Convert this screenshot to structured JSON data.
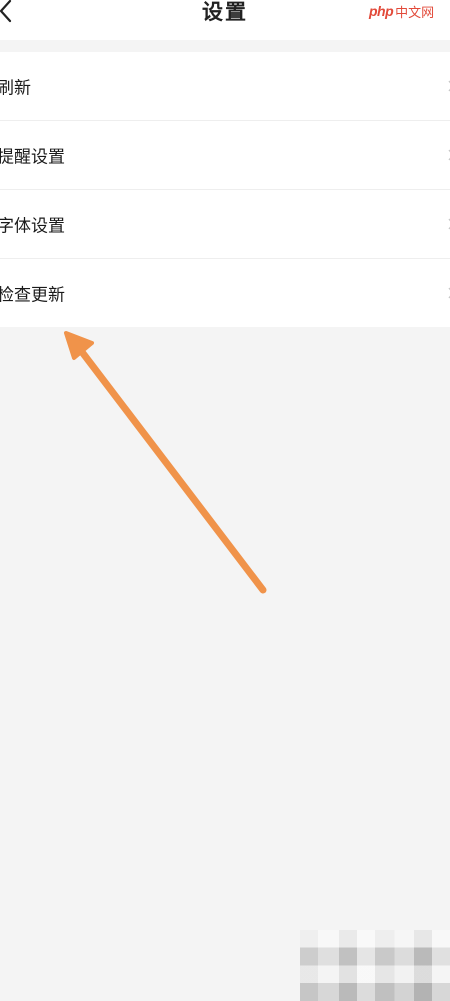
{
  "header": {
    "title": "设置",
    "back_icon": "chevron-left-icon"
  },
  "watermark": {
    "brand": "php",
    "site": "中文网",
    "color": "#e24a3a"
  },
  "settings": {
    "items": [
      {
        "label": "刷新"
      },
      {
        "label": "提醒设置"
      },
      {
        "label": "字体设置"
      },
      {
        "label": "检查更新"
      }
    ]
  },
  "annotation": {
    "arrow_color": "#f0934a",
    "points_to": "检查更新"
  },
  "colors": {
    "page_background": "#f4f4f4",
    "row_background": "#ffffff",
    "divider": "#eeeeee"
  }
}
